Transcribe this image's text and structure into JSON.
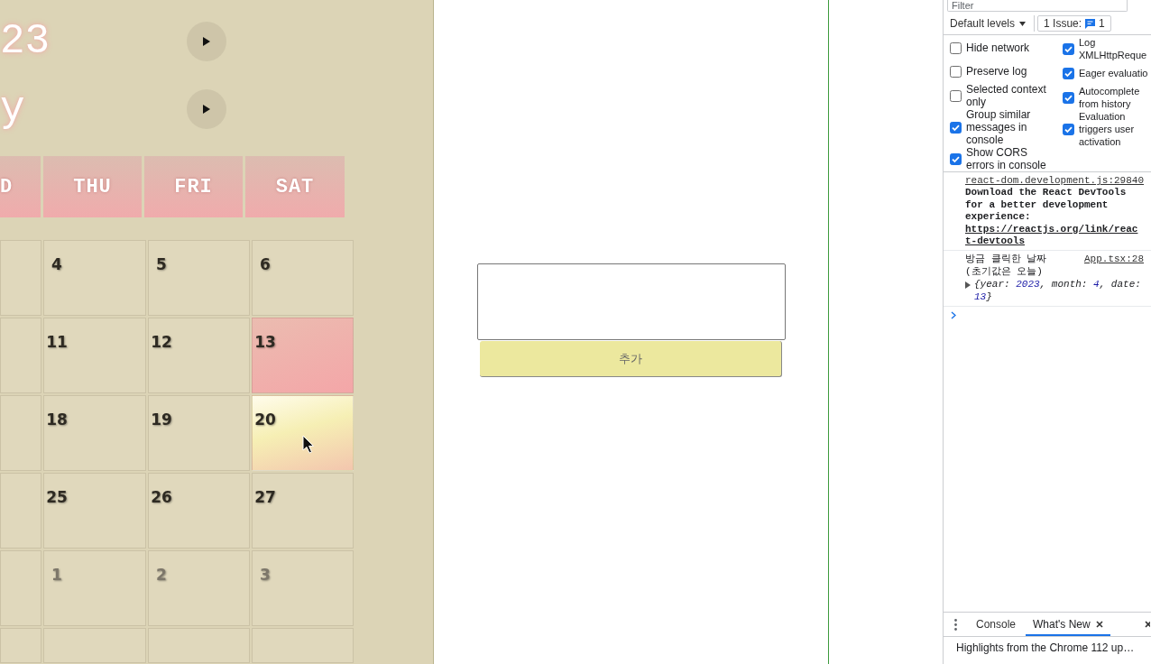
{
  "calendar": {
    "year_heading": "23",
    "month_heading": "y",
    "weekdays": [
      "D",
      "THU",
      "FRI",
      "SAT"
    ],
    "weeks": [
      {
        "days": [
          {
            "number": "4",
            "selected": false,
            "hovered": false,
            "outside_month": false
          },
          {
            "number": "5",
            "selected": false,
            "hovered": false,
            "outside_month": false
          },
          {
            "number": "6",
            "selected": false,
            "hovered": false,
            "outside_month": false
          }
        ]
      },
      {
        "days": [
          {
            "number": "11",
            "selected": false,
            "hovered": false,
            "outside_month": false
          },
          {
            "number": "12",
            "selected": false,
            "hovered": false,
            "outside_month": false
          },
          {
            "number": "13",
            "selected": true,
            "hovered": false,
            "outside_month": false
          }
        ]
      },
      {
        "days": [
          {
            "number": "18",
            "selected": false,
            "hovered": false,
            "outside_month": false
          },
          {
            "number": "19",
            "selected": false,
            "hovered": false,
            "outside_month": false
          },
          {
            "number": "20",
            "selected": false,
            "hovered": true,
            "outside_month": false
          }
        ]
      },
      {
        "days": [
          {
            "number": "25",
            "selected": false,
            "hovered": false,
            "outside_month": false
          },
          {
            "number": "26",
            "selected": false,
            "hovered": false,
            "outside_month": false
          },
          {
            "number": "27",
            "selected": false,
            "hovered": false,
            "outside_month": false
          }
        ]
      },
      {
        "days": [
          {
            "number": "1",
            "selected": false,
            "hovered": false,
            "outside_month": true
          },
          {
            "number": "2",
            "selected": false,
            "hovered": false,
            "outside_month": true
          },
          {
            "number": "3",
            "selected": false,
            "hovered": false,
            "outside_month": true
          }
        ]
      }
    ]
  },
  "memo": {
    "add_button": "추가"
  },
  "devtools": {
    "filter": {
      "placeholder": "Filter"
    },
    "levels_dropdown": "Default levels",
    "issues_button": {
      "label": "1 Issue:",
      "count": "1"
    },
    "settings_columns": [
      {
        "items": [
          {
            "label": "Hide network",
            "checked": false
          },
          {
            "label": "Preserve log",
            "checked": false
          },
          {
            "label": "Selected context only",
            "checked": false
          },
          {
            "label": "Group similar messages in console",
            "checked": true
          },
          {
            "label": "Show CORS errors in console",
            "checked": true
          }
        ]
      },
      {
        "items": [
          {
            "label": "Log XMLHttpReque",
            "checked": true
          },
          {
            "label": "Eager evaluatio",
            "checked": true
          },
          {
            "label": "Autocomplete from history",
            "checked": true
          },
          {
            "label": "Evaluation triggers user activation",
            "checked": true
          }
        ]
      }
    ],
    "messages": [
      {
        "kind": "info",
        "source": "react-dom.development.js:29840",
        "text": "Download the React DevTools for a better development experience:",
        "link": "https://reactjs.org/link/react-devtools"
      },
      {
        "kind": "log",
        "source": "App.tsx:28",
        "text": "방금 클릭한 날짜(초기값은 오늘)",
        "expanded": false,
        "object_parts": [
          {
            "text": "{year: ",
            "kind": "key"
          },
          {
            "text": "2023",
            "kind": "number"
          },
          {
            "text": ", month: ",
            "kind": "key"
          },
          {
            "text": "4",
            "kind": "number"
          },
          {
            "text": ", date: ",
            "kind": "key"
          },
          {
            "text": "13",
            "kind": "number"
          },
          {
            "text": "}",
            "kind": "key"
          }
        ]
      }
    ],
    "drawer_tabs": [
      {
        "label": "Console",
        "selected": false,
        "closable": false
      },
      {
        "label": "What's New",
        "selected": true,
        "closable": true
      }
    ],
    "drawer_text": "Highlights from the Chrome 112 up…"
  }
}
